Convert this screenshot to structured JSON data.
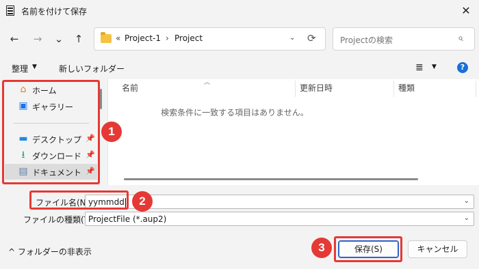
{
  "window": {
    "title": "名前を付けて保存",
    "close_glyph": "✕"
  },
  "nav": {
    "back": "←",
    "forward": "→",
    "recent": "⌄",
    "up": "↑"
  },
  "address": {
    "overflow": "«",
    "crumbs": [
      "Project-1",
      "Project"
    ],
    "separator": "›",
    "dropdown": "⌄",
    "refresh": "⟳"
  },
  "search": {
    "placeholder": "Projectの検索",
    "icon": "⌕"
  },
  "toolbar": {
    "organize_label": "整理",
    "caret": "▼",
    "new_folder_label": "新しいフォルダー",
    "view_icon": "≣",
    "help_label": "?"
  },
  "sidebar": {
    "items": [
      {
        "label": "ホーム",
        "icon": "home-icon",
        "glyph": "⌂",
        "color": "#d9822b"
      },
      {
        "label": "ギャラリー",
        "icon": "gallery-icon",
        "glyph": "▣",
        "color": "#1a73e8"
      },
      {
        "label": "デスクトップ",
        "icon": "desktop-icon",
        "glyph": "▬",
        "color": "#1e88e5"
      },
      {
        "label": "ダウンロード",
        "icon": "download-icon",
        "glyph": "⭳",
        "color": "#1b9e5a"
      },
      {
        "label": "ドキュメント",
        "icon": "document-icon",
        "glyph": "▤",
        "color": "#5f7fa8"
      }
    ],
    "pin_glyph": "📌"
  },
  "columns": {
    "name": "名前",
    "modified": "更新日時",
    "type": "種類",
    "sort_glyph": "︿"
  },
  "empty_message": "検索条件に一致する項目はありません。",
  "filename": {
    "label": "ファイル名(N):",
    "value": "yymmdd"
  },
  "filetype": {
    "label": "ファイルの種類(T):",
    "value": "ProjectFile (*.aup2)"
  },
  "field_caret": "⌄",
  "footer": {
    "toggle_label": "^  フォルダーの非表示",
    "save_label": "保存(S)",
    "cancel_label": "キャンセル"
  },
  "annotations": {
    "badge1": "1",
    "badge2": "2",
    "badge3": "3"
  },
  "colors": {
    "annotation_red": "#e53935",
    "primary_border": "#2d63c8",
    "accent": "#1a6fd8"
  }
}
